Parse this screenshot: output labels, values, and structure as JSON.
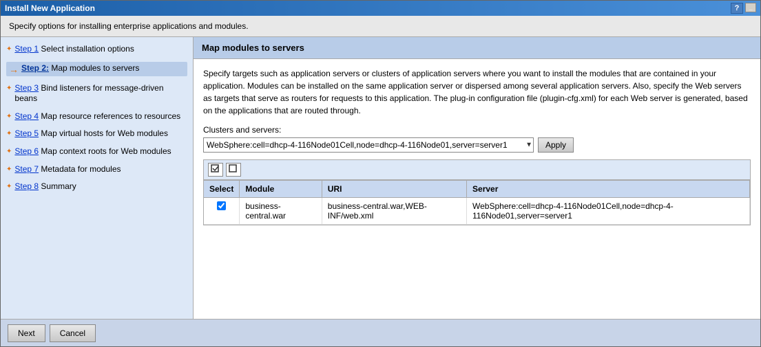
{
  "window": {
    "title": "Install New Application",
    "help_label": "?",
    "minimize_label": "_",
    "close_label": "×"
  },
  "subtitle": "Specify options for installing enterprise applications and modules.",
  "sidebar": {
    "items": [
      {
        "id": "step1",
        "step_link": "Step 1",
        "description": " Select installation options",
        "active": false,
        "marker": "diamond"
      },
      {
        "id": "step2",
        "step_link": "Step 2:",
        "description": " Map modules to servers",
        "active": true,
        "marker": "arrow"
      },
      {
        "id": "step3",
        "step_link": "Step 3",
        "description": " Bind listeners for message-driven beans",
        "active": false,
        "marker": "diamond"
      },
      {
        "id": "step4",
        "step_link": "Step 4",
        "description": " Map resource references to resources",
        "active": false,
        "marker": "diamond"
      },
      {
        "id": "step5",
        "step_link": "Step 5",
        "description": " Map virtual hosts for Web modules",
        "active": false,
        "marker": "diamond"
      },
      {
        "id": "step6",
        "step_link": "Step 6",
        "description": " Map context roots for Web modules",
        "active": false,
        "marker": "diamond"
      },
      {
        "id": "step7",
        "step_link": "Step 7",
        "description": " Metadata for modules",
        "active": false,
        "marker": "diamond"
      },
      {
        "id": "step8",
        "step_link": "Step 8",
        "description": " Summary",
        "active": false,
        "marker": "diamond"
      }
    ]
  },
  "panel": {
    "title": "Map modules to servers",
    "description": "Specify targets such as application servers or clusters of application servers where you want to install the modules that are contained in your application. Modules can be installed on the same application server or dispersed among several application servers. Also, specify the Web servers as targets that serve as routers for requests to this application. The plug-in configuration file (plugin-cfg.xml) for each Web server is generated, based on the applications that are routed through.",
    "clusters_label": "Clusters and servers:",
    "clusters_value": "WebSphere:cell=dhcp-4-116Node01Cell,node=dhcp-4-116Node01,server=server1",
    "apply_label": "Apply",
    "select_all_icon": "☐+",
    "deselect_all_icon": "☑-",
    "table": {
      "columns": [
        "Select",
        "Module",
        "URI",
        "Server"
      ],
      "rows": [
        {
          "selected": true,
          "module": "business-central.war",
          "uri": "business-central.war,WEB-INF/web.xml",
          "server": "WebSphere:cell=dhcp-4-116Node01Cell,node=dhcp-4-116Node01,server=server1"
        }
      ]
    }
  },
  "footer": {
    "next_label": "Next",
    "cancel_label": "Cancel"
  }
}
